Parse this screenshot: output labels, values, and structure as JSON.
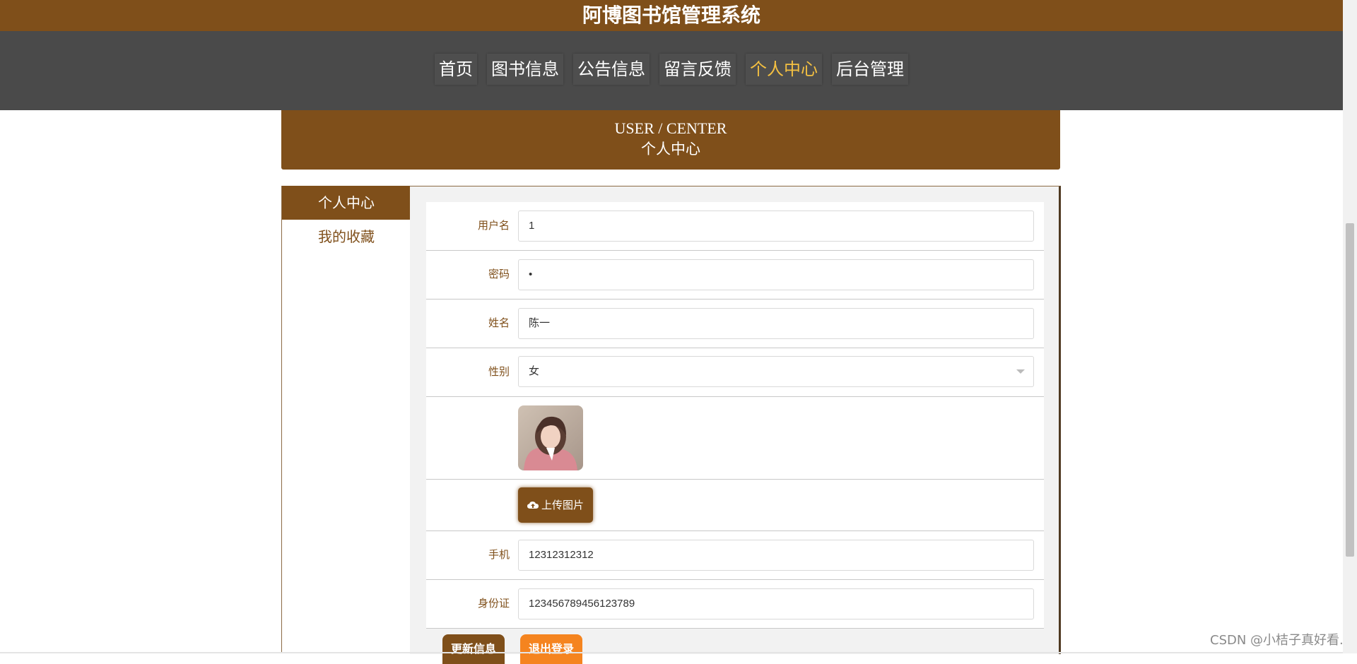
{
  "site_title": "阿博图书馆管理系统",
  "nav": {
    "items": [
      {
        "label": "首页"
      },
      {
        "label": "图书信息"
      },
      {
        "label": "公告信息"
      },
      {
        "label": "留言反馈"
      },
      {
        "label": "个人中心",
        "active": true
      },
      {
        "label": "后台管理"
      }
    ]
  },
  "banner": {
    "en": "USER / CENTER",
    "cn": "个人中心"
  },
  "sidebar": {
    "items": [
      {
        "label": "个人中心",
        "active": true
      },
      {
        "label": "我的收藏"
      }
    ]
  },
  "form": {
    "username": {
      "label": "用户名",
      "value": "1"
    },
    "password": {
      "label": "密码",
      "value": "•"
    },
    "name": {
      "label": "姓名",
      "value": "陈一"
    },
    "gender": {
      "label": "性别",
      "value": "女"
    },
    "upload_label": "上传图片",
    "phone": {
      "label": "手机",
      "value": "12312312312"
    },
    "id_card": {
      "label": "身份证",
      "value": "123456789456123789"
    }
  },
  "buttons": {
    "update": "更新信息",
    "logout": "退出登录"
  },
  "watermark": "CSDN @小桔子真好看.",
  "colors": {
    "primary": "#7f4f1a",
    "nav_bg": "#4a4a4a",
    "active_nav": "#f4c041",
    "logout": "#f5841f"
  }
}
